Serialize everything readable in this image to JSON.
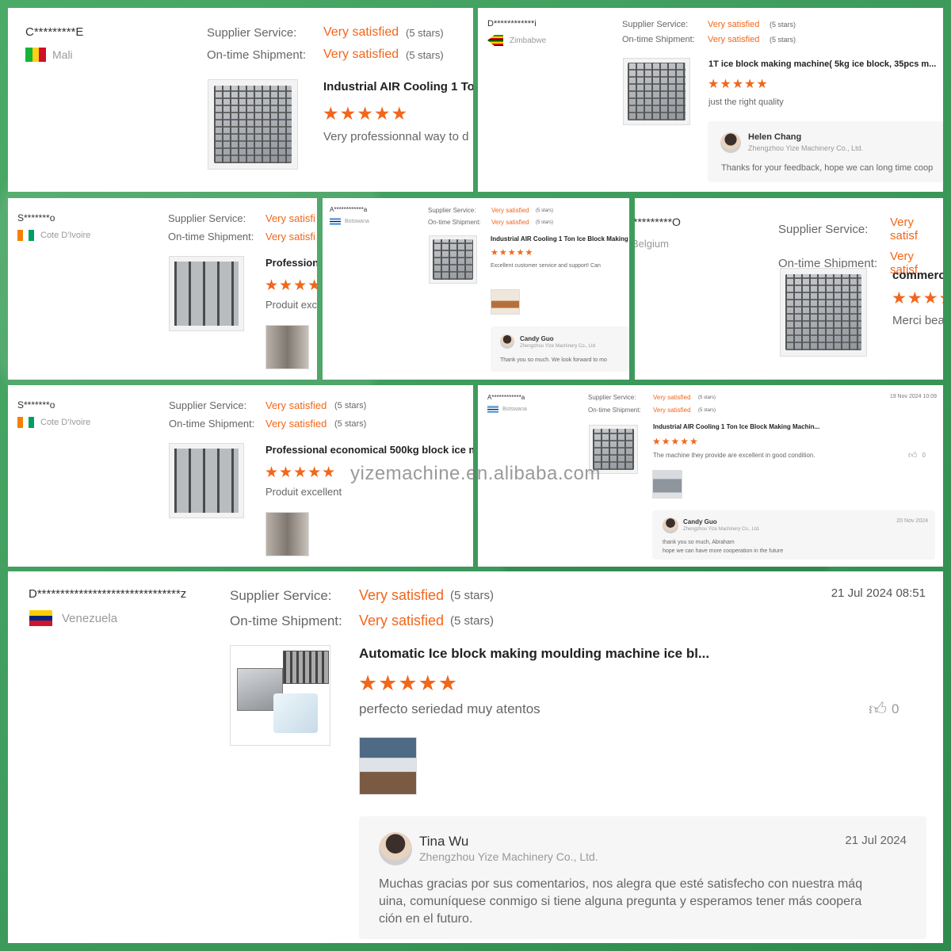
{
  "labels": {
    "supplier_service": "Supplier Service:",
    "ontime_shipment": "On-time Shipment:",
    "very_satisfied": "Very satisfied",
    "five_stars": "(5 stars)",
    "star_glyphs": "★★★★★"
  },
  "reviews": [
    {
      "user": "C*********E",
      "country": "Mali",
      "flag_colors": [
        "#14b53a",
        "#fcd116",
        "#ce1126"
      ],
      "product": "Industrial AIR Cooling 1 Ton",
      "comment": "Very professionnal way to d"
    },
    {
      "user": "D************i",
      "country": "Zimbabwe",
      "flag_colors": [
        "#319208",
        "#ffd200",
        "#d40000",
        "#000000"
      ],
      "product": "1T ice block making machine( 5kg ice block, 35pcs m...",
      "comment": "just the right quality",
      "reply": {
        "name": "Helen Chang",
        "company": "Zhengzhou Yize Machinery Co., Ltd.",
        "text": "Thanks for your feedback, hope we can long time coop"
      }
    },
    {
      "user": "S*******o",
      "country": "Cote D'Ivoire",
      "flag_colors": [
        "#f77f00",
        "#ffffff",
        "#009e60"
      ],
      "product": "Profession",
      "comment": "Produit exc",
      "val_short": "Very satisfi"
    },
    {
      "user": "A************a",
      "country": "Botswana",
      "flag_colors": [
        "#75aadb",
        "#ffffff",
        "#000000"
      ],
      "product": "Industrial AIR Cooling 1 Ton Ice Block Making",
      "comment": "Excellent customer service and support! Can",
      "reply": {
        "name": "Candy Guo",
        "company": "Zhengzhou Yize Machinery Co., Ltd",
        "text": "Thank you so much. We look forward to mo"
      }
    },
    {
      "user": "*********O",
      "country": "Belgium",
      "product": "commerci",
      "comment": "Merci bea",
      "val_short": "Very satisf"
    },
    {
      "user": "S*******o",
      "country": "Cote D'Ivoire",
      "flag_colors": [
        "#f77f00",
        "#ffffff",
        "#009e60"
      ],
      "product": "Professional economical 500kg block ice ma",
      "comment": "Produit excellent"
    },
    {
      "user": "A************a",
      "country": "Botswana",
      "flag_colors": [
        "#75aadb",
        "#ffffff",
        "#000000"
      ],
      "date": "19 Nov 2024 10:09",
      "product": "Industrial AIR Cooling 1 Ton Ice Block Making Machin...",
      "comment": "The machine they provide are excellent in good condition.",
      "likes": "0",
      "reply": {
        "name": "Candy Guo",
        "company": "Zhengzhou Yize Machinery Co., Ltd.",
        "date": "20 Nov 2024",
        "text1": "thank you so much, Abraham",
        "text2": "hope we can have more cooperation in the future"
      }
    },
    {
      "user": "D*******************************z",
      "country": "Venezuela",
      "flag_colors": [
        "#ffcc00",
        "#00247d",
        "#cf142b"
      ],
      "date": "21 Jul 2024 08:51",
      "product": "Automatic Ice block making moulding machine ice bl...",
      "comment": "perfecto seriedad muy atentos",
      "likes": "0",
      "reply": {
        "name": "Tina Wu",
        "company": "Zhengzhou Yize Machinery Co., Ltd.",
        "date": "21 Jul 2024",
        "text1": "Muchas gracias por sus comentarios, nos alegra que esté satisfecho con nuestra máq",
        "text2": "uina, comuníquese conmigo si tiene alguna pregunta y esperamos tener más coopera",
        "text3": "ción en el futuro."
      }
    }
  ],
  "watermark": "yizemachine.en.alibaba.com"
}
